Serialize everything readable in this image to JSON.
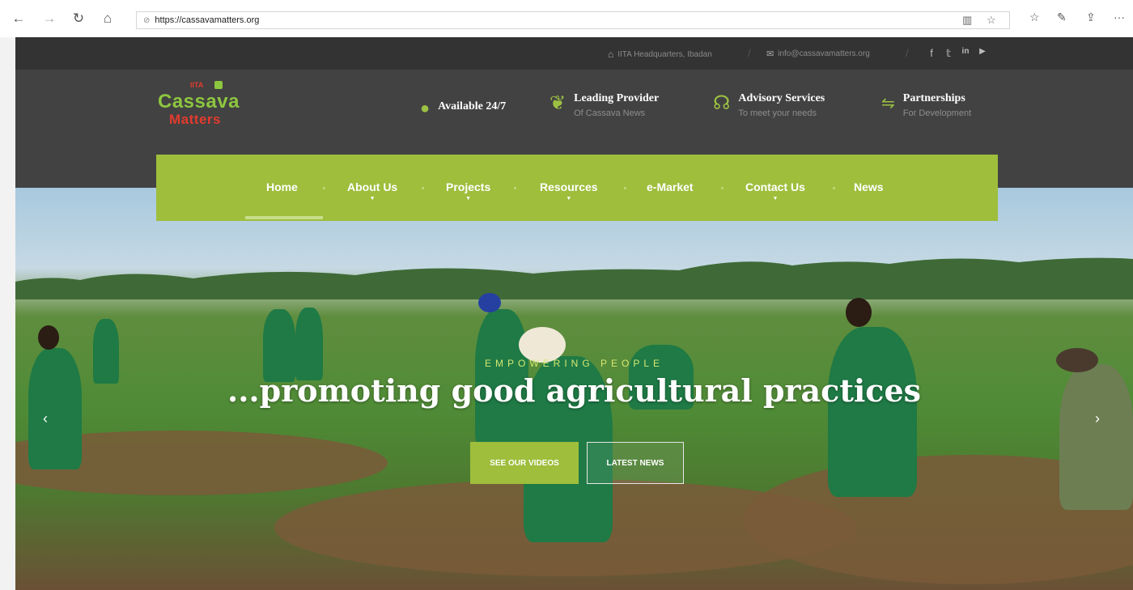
{
  "browser": {
    "back": "←",
    "forward": "→",
    "refresh": "↻",
    "home": "⌂",
    "url": "https://cassavamatters.org",
    "reading_view": "▥",
    "favorite": "☆",
    "favorites_hub": "☆",
    "notes": "✎",
    "share": "⇪",
    "more": "···"
  },
  "topbar": {
    "location": "IITA Headquarters, Ibadan",
    "email": "info@cassavamatters.org",
    "social": [
      "f",
      "𝕥",
      "in",
      "▶"
    ]
  },
  "logo": {
    "org": "IITA",
    "line1": "Cassava",
    "line2": "Matters"
  },
  "features": [
    {
      "icon": "clock-icon",
      "title": "Available 24/7",
      "subtitle": ""
    },
    {
      "icon": "leaf-icon",
      "title": "Leading Provider",
      "subtitle": "Of Cassava News"
    },
    {
      "icon": "headset-icon",
      "title": "Advisory Services",
      "subtitle": "To meet your needs"
    },
    {
      "icon": "handshake-icon",
      "title": "Partnerships",
      "subtitle": "For Development"
    }
  ],
  "nav": {
    "items": [
      {
        "label": "Home",
        "has_caret": false,
        "active": true
      },
      {
        "label": "About Us",
        "has_caret": true
      },
      {
        "label": "Projects",
        "has_caret": true
      },
      {
        "label": "Resources",
        "has_caret": true
      },
      {
        "label": "e-Market",
        "has_caret": false
      },
      {
        "label": "Contact Us",
        "has_caret": true
      },
      {
        "label": "News",
        "has_caret": false
      }
    ]
  },
  "hero": {
    "kicker": "EMPOWERING PEOPLE",
    "headline": "...promoting good agricultural practices",
    "button_primary": "SEE OUR VIDEOS",
    "button_secondary": "LATEST NEWS",
    "prev": "‹",
    "next": "›"
  },
  "colors": {
    "accent": "#9ebe3c",
    "header_bg": "#424242",
    "topbar_bg": "#333333",
    "logo_red": "#e23b2e"
  }
}
